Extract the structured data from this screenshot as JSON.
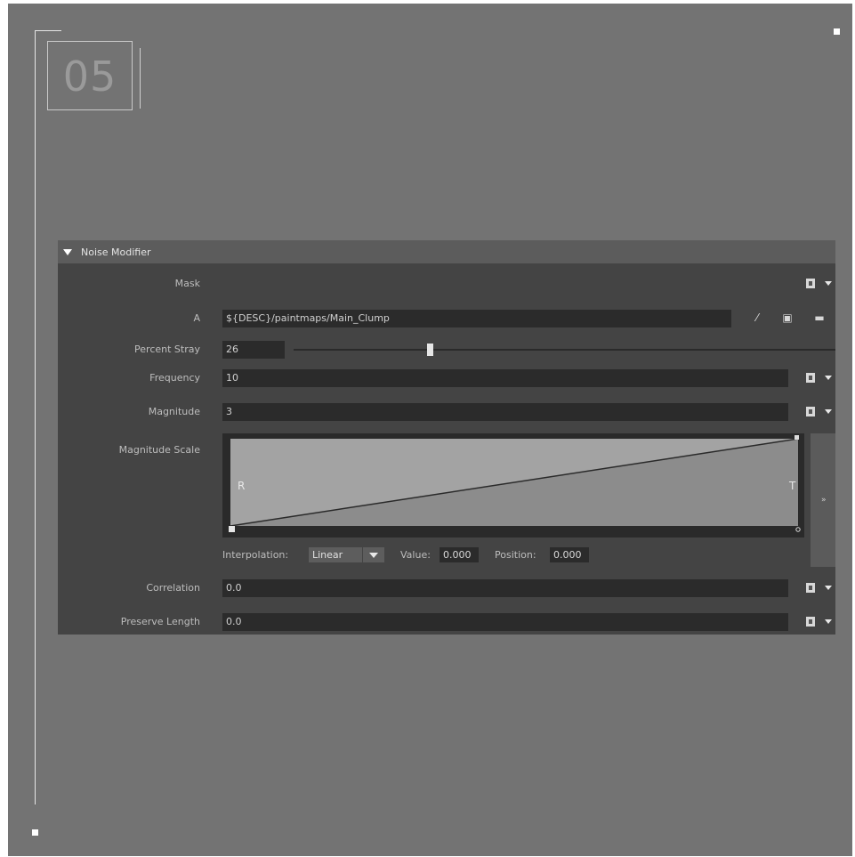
{
  "slide_number": "05",
  "panel": {
    "section_title": "Noise Modifier",
    "rows": {
      "mask": {
        "label": "Mask"
      },
      "a": {
        "label": "A",
        "value": "${DESC}/paintmaps/Main_Clump"
      },
      "percent_stray": {
        "label": "Percent Stray",
        "value": "26",
        "slider_fraction": 0.26
      },
      "frequency": {
        "label": "Frequency",
        "value": "10"
      },
      "magnitude": {
        "label": "Magnitude",
        "value": "3"
      },
      "magnitude_scale": {
        "label": "Magnitude Scale",
        "ramp_left_label": "R",
        "ramp_right_label": "T",
        "interpolation_label": "Interpolation:",
        "interpolation_value": "Linear",
        "value_label": "Value:",
        "value": "0.000",
        "position_label": "Position:",
        "position": "0.000",
        "side_button": "»"
      },
      "correlation": {
        "label": "Correlation",
        "value": "0.0"
      },
      "preserve_length": {
        "label": "Preserve Length",
        "value": "0.0"
      }
    }
  },
  "icons": [
    "map-button-icon",
    "dropdown-arrow-icon",
    "paint-brush-icon",
    "save-icon",
    "folder-icon"
  ],
  "colors": {
    "background": "#737373",
    "panel": "#444444",
    "field": "#2b2b2b",
    "ramp_fill": "#9a9a9a"
  }
}
